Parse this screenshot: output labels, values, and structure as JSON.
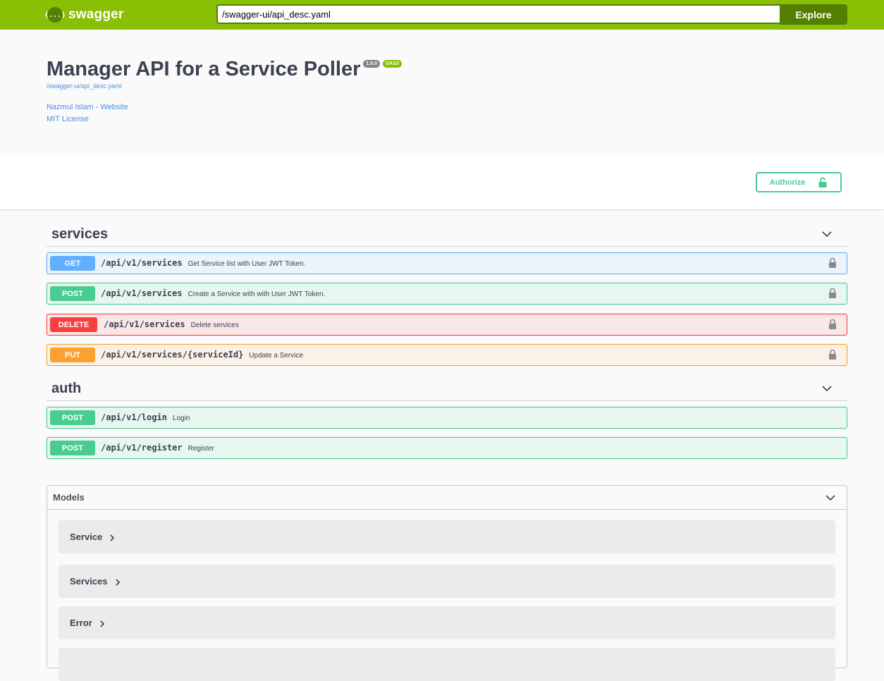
{
  "topbar": {
    "logo_icon": "{...}",
    "brand": "swagger",
    "url_value": "/swagger-ui/api_desc.yaml",
    "explore_label": "Explore",
    "brand_color": "#89bf04"
  },
  "info": {
    "title": "Manager API for a Service Poller",
    "version": "1.0.0",
    "oas": "OAS3",
    "spec_url": "/swagger-ui/api_desc.yaml",
    "contact": "Nazmul Islam - Website",
    "license": "MIT License"
  },
  "authorize": {
    "label": "Authorize",
    "icon": "unlocked-lock-icon"
  },
  "tags": [
    {
      "name": "services",
      "operations": [
        {
          "method": "GET",
          "path": "/api/v1/services",
          "summary": "Get Service list with User JWT Token."
        },
        {
          "method": "POST",
          "path": "/api/v1/services",
          "summary": "Create a Service with with User JWT Token."
        },
        {
          "method": "DELETE",
          "path": "/api/v1/services",
          "summary": "Delete services"
        },
        {
          "method": "PUT",
          "path": "/api/v1/services/{serviceId}",
          "summary": "Update a Service"
        }
      ]
    },
    {
      "name": "auth",
      "operations": [
        {
          "method": "POST",
          "path": "/api/v1/login",
          "summary": "Login"
        },
        {
          "method": "POST",
          "path": "/api/v1/register",
          "summary": "Register"
        }
      ]
    }
  ],
  "models": {
    "title": "Models",
    "items": [
      "Service",
      "Services",
      "Error"
    ]
  },
  "colors": {
    "get": "#61affe",
    "post": "#49cc90",
    "delete": "#f93e3e",
    "put": "#fca130"
  }
}
